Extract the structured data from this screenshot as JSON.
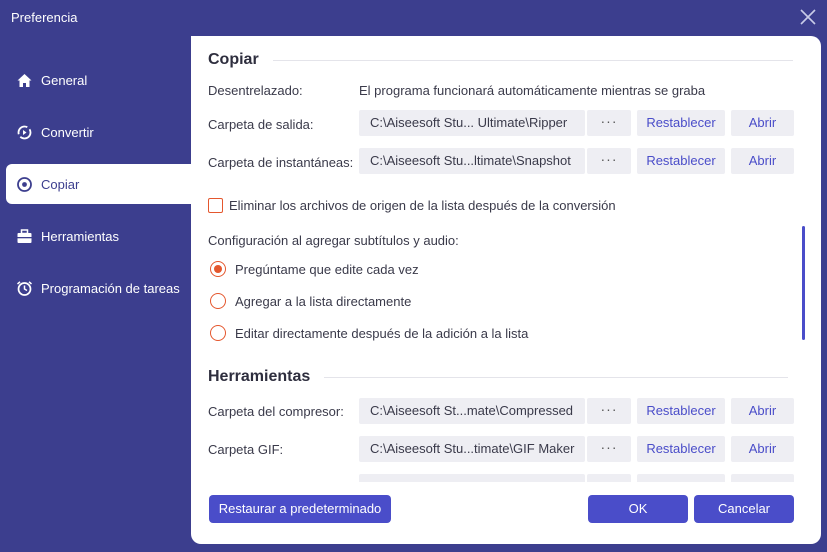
{
  "window": {
    "title": "Preferencia",
    "close_icon": "close-icon"
  },
  "sidebar": {
    "items": [
      {
        "label": "General",
        "icon": "home-icon",
        "active": false
      },
      {
        "label": "Convertir",
        "icon": "convert-icon",
        "active": false
      },
      {
        "label": "Copiar",
        "icon": "disc-icon",
        "active": true
      },
      {
        "label": "Herramientas",
        "icon": "toolbox-icon",
        "active": false
      },
      {
        "label": "Programación de tareas",
        "icon": "alarm-clock-icon",
        "active": false
      }
    ]
  },
  "copiar": {
    "title": "Copiar",
    "deinterlace_label": "Desentrelazado:",
    "deinterlace_value": "El programa funcionará automáticamente mientras se graba",
    "output_folder": {
      "label": "Carpeta de salida:",
      "path": "C:\\Aiseesoft Stu... Ultimate\\Ripper",
      "dots": "···",
      "reset": "Restablecer",
      "open": "Abrir"
    },
    "snapshot_folder": {
      "label": "Carpeta de instantáneas:",
      "path": "C:\\Aiseesoft Stu...ltimate\\Snapshot",
      "dots": "···",
      "reset": "Restablecer",
      "open": "Abrir"
    },
    "delete_source_label": "Eliminar los archivos de origen de la lista después de la conversión",
    "delete_source_checked": false,
    "subtitle_config_label": "Configuración al agregar subtítulos y audio:",
    "options": [
      {
        "label": "Pregúntame que edite cada vez",
        "selected": true
      },
      {
        "label": "Agregar a la lista directamente",
        "selected": false
      },
      {
        "label": "Editar directamente después de la adición a la lista",
        "selected": false
      }
    ]
  },
  "herramientas": {
    "title": "Herramientas",
    "compressor_folder": {
      "label": "Carpeta del compresor:",
      "path": "C:\\Aiseesoft St...mate\\Compressed",
      "dots": "···",
      "reset": "Restablecer",
      "open": "Abrir"
    },
    "gif_folder": {
      "label": "Carpeta GIF:",
      "path": "C:\\Aiseesoft Stu...timate\\GIF Maker",
      "dots": "···",
      "reset": "Restablecer",
      "open": "Abrir"
    }
  },
  "footer": {
    "restore_default": "Restaurar a predeterminado",
    "ok": "OK",
    "cancel": "Cancelar"
  },
  "colors": {
    "background": "#3c3e8e",
    "accent": "#4a4dc9",
    "radio_accent": "#e4572e",
    "field_bg": "#eeeef3"
  }
}
